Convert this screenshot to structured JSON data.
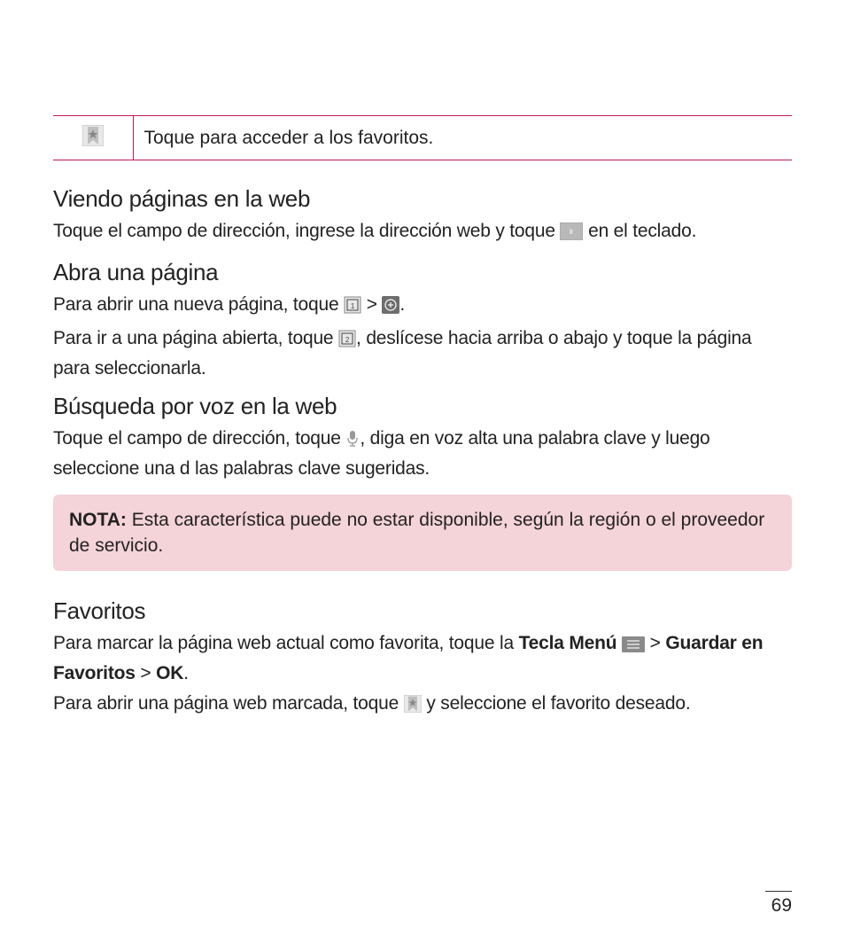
{
  "topbox": {
    "desc": "Toque para acceder a los favoritos."
  },
  "section1": {
    "title": "Viendo páginas en la web",
    "p1a": "Toque el campo de dirección, ingrese la dirección web y toque ",
    "p1b": " en el teclado."
  },
  "section2": {
    "title": "Abra una página",
    "p1a": "Para abrir una nueva página, toque ",
    "p1_gt": " > ",
    "p1b": ".",
    "p2a": "Para ir a una página abierta, toque ",
    "p2b": ", deslícese hacia arriba o abajo y toque la página para seleccionarla."
  },
  "section3": {
    "title": "Búsqueda por voz en la web",
    "p1a": "Toque el campo de dirección, toque ",
    "p1b": ", diga en voz alta una palabra clave y luego seleccione una d las palabras clave sugeridas."
  },
  "note": {
    "label": "NOTA:",
    "text": " Esta característica puede no estar disponible, según la región o el proveedor de servicio."
  },
  "section4": {
    "title": "Favoritos",
    "p1a": "Para marcar la página web actual como favorita, toque la ",
    "p1_bold1": "Tecla Menú",
    "p1_gt1": " > ",
    "p1_bold2": "Guardar en Favoritos",
    "p1_gt2": " > ",
    "p1_bold3": "OK",
    "p1_end": ".",
    "p2a": "Para abrir una página web marcada, toque ",
    "p2b": " y seleccione el favorito deseado."
  },
  "pagenum": "69"
}
